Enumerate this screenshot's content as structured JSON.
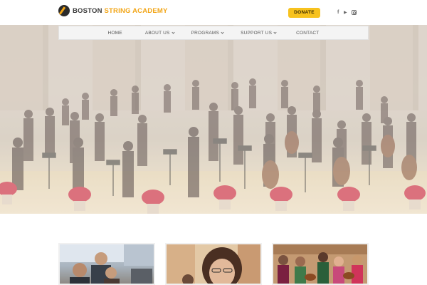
{
  "header": {
    "logo_text_a": "BOSTON",
    "logo_text_b": "STRING ACADEMY",
    "donate_label": "DONATE",
    "social": [
      {
        "icon": "facebook-icon",
        "glyph": "f"
      },
      {
        "icon": "youtube-icon",
        "glyph": "▶"
      },
      {
        "icon": "instagram-icon",
        "glyph": ""
      }
    ]
  },
  "nav": {
    "items": [
      {
        "label": "HOME",
        "has_dropdown": false
      },
      {
        "label": "ABOUT US",
        "has_dropdown": true
      },
      {
        "label": "PROGRAMS",
        "has_dropdown": true
      },
      {
        "label": "SUPPORT US",
        "has_dropdown": true
      },
      {
        "label": "CONTACT",
        "has_dropdown": false
      }
    ]
  },
  "colors": {
    "accent": "#f7c21e",
    "logo_accent": "#f2a516",
    "nav_bg": "#f4f4f4",
    "text_dark": "#3a3a3a"
  }
}
